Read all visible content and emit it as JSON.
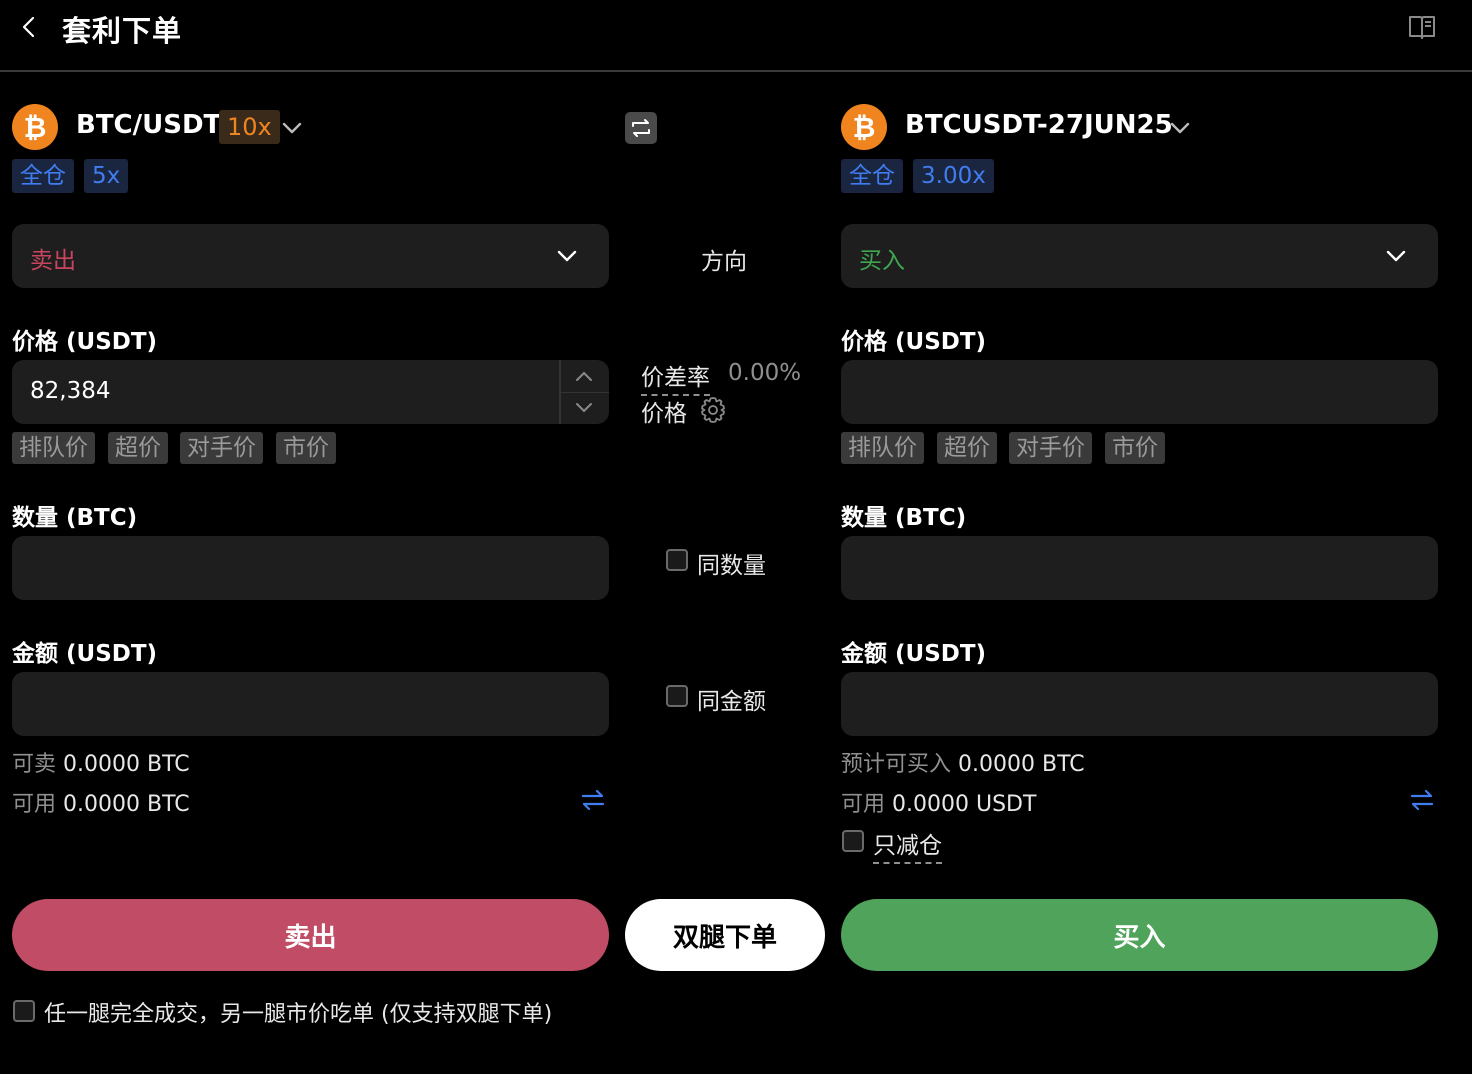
{
  "header": {
    "title": "套利下单"
  },
  "left": {
    "pair": "BTC/USDT",
    "leverage": "10x",
    "coin_symbol": "₿",
    "tags": [
      "全仓",
      "5x"
    ],
    "direction": "卖出",
    "price_label": "价格 (USDT)",
    "price_value": "82,384",
    "quick_prices": [
      "排队价",
      "超价",
      "对手价",
      "市价"
    ],
    "qty_label": "数量 (BTC)",
    "amount_label": "金额 (USDT)",
    "info1_label": "可卖",
    "info1_value": "0.0000 BTC",
    "info2_label": "可用",
    "info2_value": "0.0000 BTC",
    "button": "卖出"
  },
  "right": {
    "pair": "BTCUSDT-27JUN25",
    "coin_symbol": "₿",
    "tags": [
      "全仓",
      "3.00x"
    ],
    "direction": "买入",
    "price_label": "价格 (USDT)",
    "price_value": "",
    "quick_prices": [
      "排队价",
      "超价",
      "对手价",
      "市价"
    ],
    "qty_label": "数量 (BTC)",
    "amount_label": "金额 (USDT)",
    "info1_label": "预计可买入",
    "info1_value": "0.0000 BTC",
    "info2_label": "可用",
    "info2_value": "0.0000 USDT",
    "reduce_only": "只减仓",
    "button": "买入"
  },
  "center": {
    "direction": "方向",
    "spread_label": "价差率",
    "spread_value": "0.00%",
    "price_label": "价格",
    "same_qty": "同数量",
    "same_amount": "同金额",
    "dual_button": "双腿下单"
  },
  "footer": {
    "option": "任一腿完全成交，另一腿市价吃单 (仅支持双腿下单)"
  },
  "colors": {
    "sell": "#c9455f",
    "buy": "#3fa652",
    "accent": "#f0851f",
    "link": "#3f7df0"
  }
}
